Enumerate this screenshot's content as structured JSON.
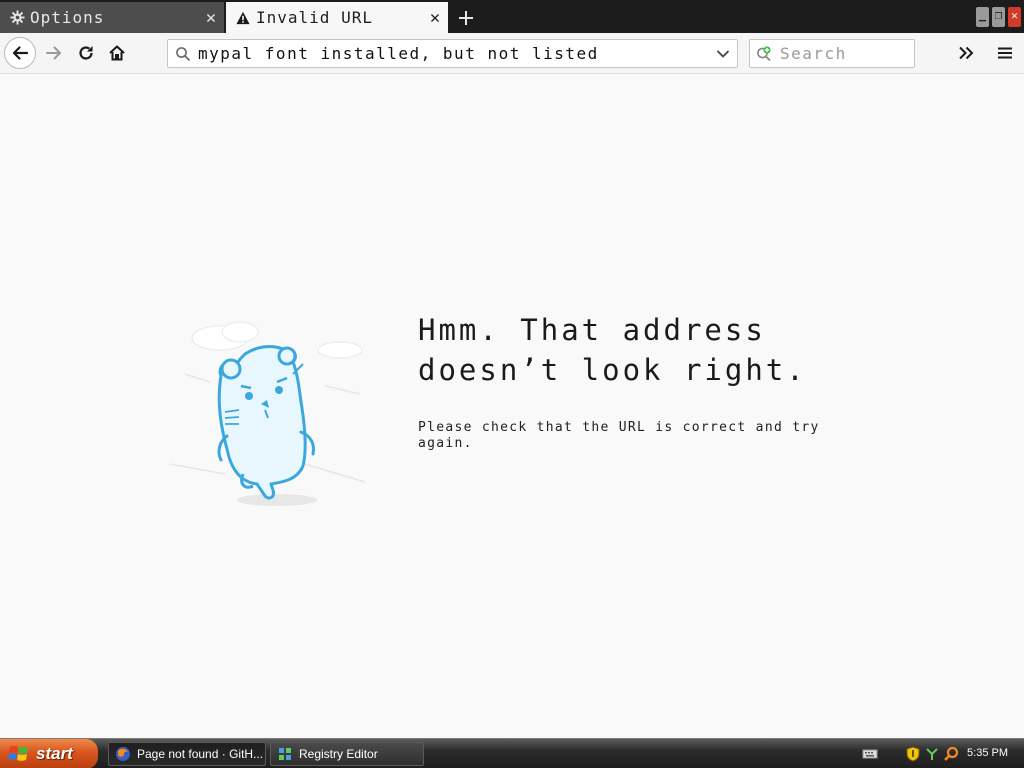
{
  "tabs": [
    {
      "label": "Options",
      "icon": "gear-icon",
      "active": false
    },
    {
      "label": "Invalid URL",
      "icon": "warning-icon",
      "active": true
    }
  ],
  "toolbar": {
    "url_value": "mypal font installed, but not listed",
    "search_placeholder": "Search"
  },
  "error_page": {
    "title": "Hmm. That address doesn’t look right.",
    "description": "Please check that the URL is correct and try again."
  },
  "taskbar": {
    "start_label": "start",
    "tasks": [
      {
        "label": "Page not found · GitH...",
        "icon": "firefox-icon",
        "active": true
      },
      {
        "label": "Registry Editor",
        "icon": "registry-editor-icon",
        "active": false
      }
    ],
    "clock": "5:35 PM"
  },
  "colors": {
    "tabstrip_bg": "#1c1c1c",
    "active_tab_bg": "#f7f7f7",
    "illustration_blue": "#3aa8dd",
    "start_orange": "#d9541c"
  }
}
